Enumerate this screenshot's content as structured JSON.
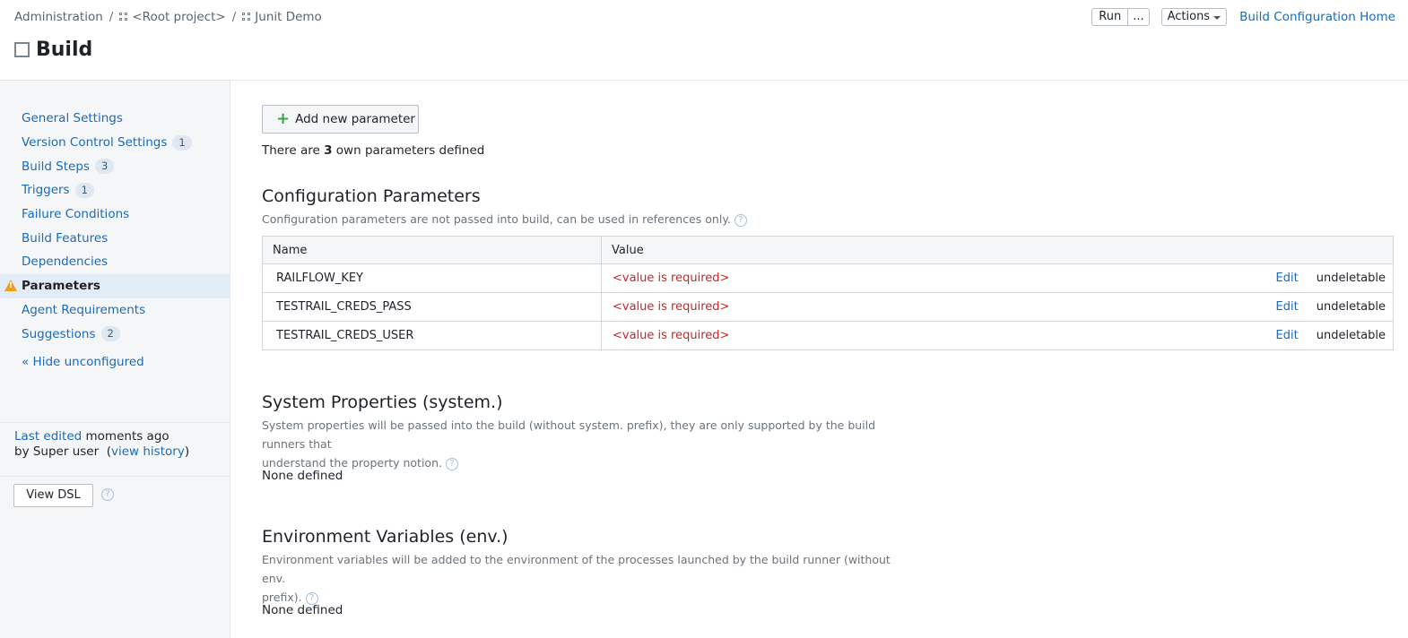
{
  "breadcrumb": {
    "admin": "Administration",
    "sep": "/",
    "root": "<Root project>",
    "project": "Junit Demo"
  },
  "title": "Build",
  "header_actions": {
    "run": "Run",
    "more": "...",
    "actions": "Actions",
    "home": "Build Configuration Home"
  },
  "sidebar": {
    "items": [
      {
        "label": "General Settings",
        "badge": ""
      },
      {
        "label": "Version Control Settings",
        "badge": "1"
      },
      {
        "label": "Build Steps",
        "badge": "3"
      },
      {
        "label": "Triggers",
        "badge": "1"
      },
      {
        "label": "Failure Conditions",
        "badge": ""
      },
      {
        "label": "Build Features",
        "badge": ""
      },
      {
        "label": "Dependencies",
        "badge": ""
      },
      {
        "label": "Parameters",
        "badge": ""
      },
      {
        "label": "Agent Requirements",
        "badge": ""
      },
      {
        "label": "Suggestions",
        "badge": "2"
      }
    ],
    "hide_unconfigured": "« Hide unconfigured",
    "last_edited_link": "Last edited",
    "last_edited_time": "moments ago",
    "by_text": "by Super user",
    "view_history": "view history",
    "view_dsl": "View DSL",
    "help_glyph": "?"
  },
  "main": {
    "add_button": "Add new parameter",
    "count_prefix": "There are",
    "count": "3",
    "count_suffix": "own parameters defined",
    "config": {
      "title": "Configuration Parameters",
      "desc": "Configuration parameters are not passed into build, can be used in references only.",
      "headers": {
        "name": "Name",
        "value": "Value"
      },
      "rows": [
        {
          "name": "RAILFLOW_KEY",
          "value": "<value is required>",
          "edit": "Edit",
          "status": "undeletable"
        },
        {
          "name": "TESTRAIL_CREDS_PASS",
          "value": "<value is required>",
          "edit": "Edit",
          "status": "undeletable"
        },
        {
          "name": "TESTRAIL_CREDS_USER",
          "value": "<value is required>",
          "edit": "Edit",
          "status": "undeletable"
        }
      ]
    },
    "system": {
      "title": "System Properties (system.)",
      "desc_line1": "System properties will be passed into the build (without system. prefix), they are only supported by the build runners that",
      "desc_line2": "understand the property notion.",
      "none": "None defined"
    },
    "env": {
      "title": "Environment Variables (env.)",
      "desc_line1": "Environment variables will be added to the environment of the processes launched by the build runner (without env.",
      "desc_line2": "prefix).",
      "none": "None defined"
    }
  }
}
